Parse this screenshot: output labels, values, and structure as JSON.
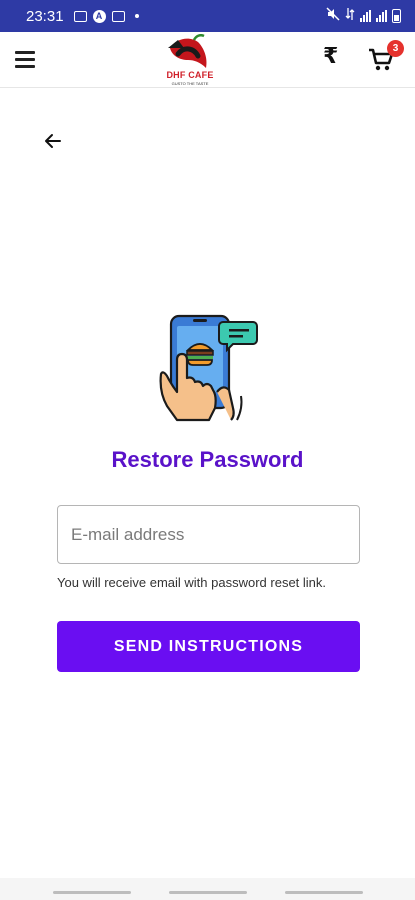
{
  "status_bar": {
    "time": "23:31"
  },
  "app_bar": {
    "logo_text": "DHF CAFE",
    "logo_tagline": "GUSTO THE TASTE",
    "currency_symbol": "₹",
    "cart_count": "3"
  },
  "page": {
    "title": "Restore Password",
    "email_placeholder": "E-mail address",
    "email_value": "",
    "hint": "You will receive email with password reset link.",
    "send_button": "SEND INSTRUCTIONS"
  },
  "colors": {
    "status_bar": "#2e3aa5",
    "accent": "#6a0ef2",
    "title": "#5a12c9",
    "badge": "#e5322d"
  },
  "icons": {
    "menu": "hamburger-icon",
    "currency": "rupee-icon",
    "cart": "cart-icon",
    "back": "arrow-left-icon",
    "illustration": "phone-chat-illustration"
  }
}
